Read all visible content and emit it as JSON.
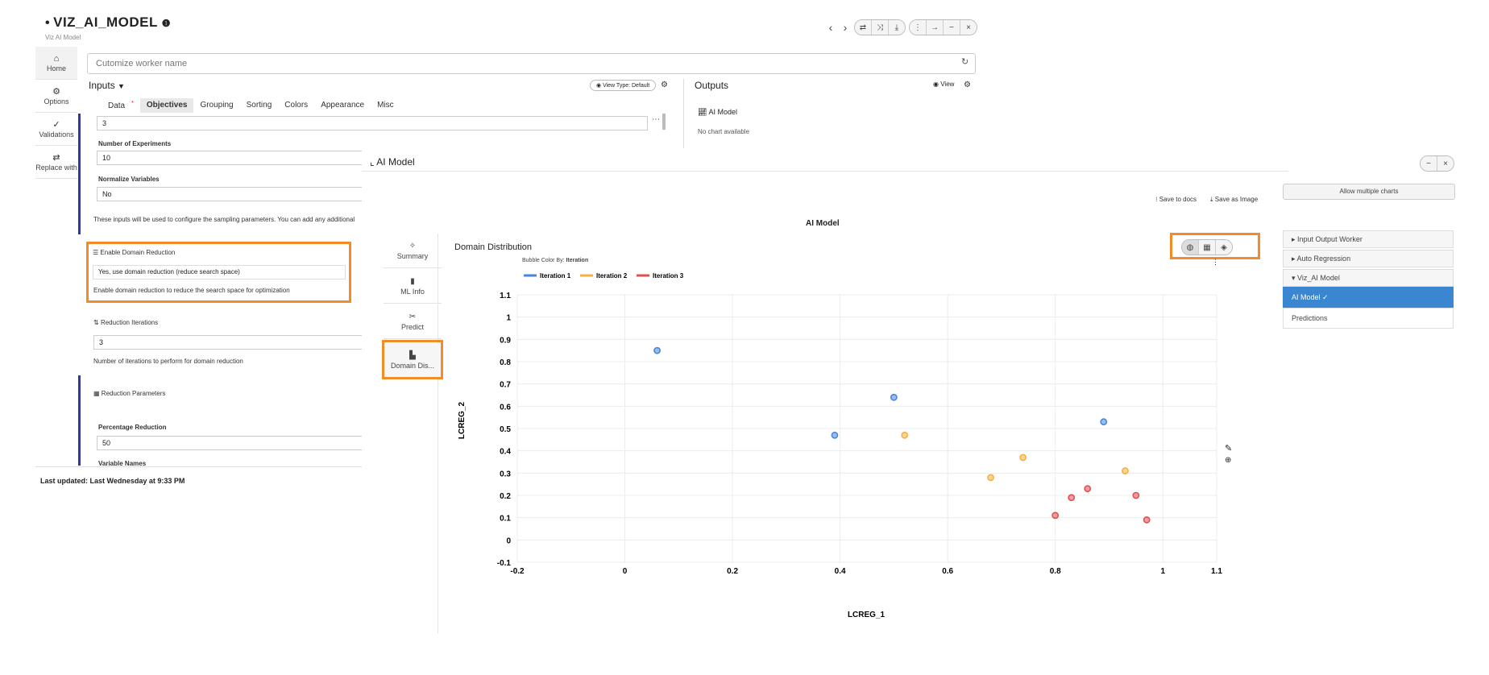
{
  "header": {
    "title": "VIZ_AI_MODEL",
    "subtitle": "Viz AI Model"
  },
  "left_nav": [
    {
      "label": "Home",
      "icon": "home-icon"
    },
    {
      "label": "Options",
      "icon": "gear-icon"
    },
    {
      "label": "Validations",
      "icon": "check-icon"
    },
    {
      "label": "Replace with",
      "icon": "swap-icon"
    }
  ],
  "worker_name": {
    "placeholder": "Cutomize worker name"
  },
  "inputs": {
    "title": "Inputs",
    "view_type": "View Type: Default",
    "tabs": [
      "Data",
      "Objectives",
      "Grouping",
      "Sorting",
      "Colors",
      "Appearance",
      "Misc"
    ],
    "active_tab": "Objectives",
    "field_top_value": "3",
    "num_experiments_label": "Number of Experiments",
    "num_experiments_value": "10",
    "normalize_label": "Normalize Variables",
    "normalize_value": "No",
    "info_text": "These inputs will be used to configure the sampling parameters. You can add any additional",
    "domain_reduction_label": "Enable Domain Reduction",
    "domain_reduction_value": "Yes, use domain reduction (reduce search space)",
    "domain_reduction_help": "Enable domain reduction to reduce the search space for optimization",
    "reduction_iterations_label": "Reduction Iterations",
    "reduction_iterations_value": "3",
    "reduction_iterations_help": "Number of iterations to perform for domain reduction",
    "reduction_params_label": "Reduction Parameters",
    "percentage_reduction_label": "Percentage Reduction",
    "percentage_reduction_value": "50",
    "variable_names_label": "Variable Names"
  },
  "outputs": {
    "title": "Outputs",
    "view_label": "View",
    "item_label": "AI Model",
    "no_chart": "No chart available"
  },
  "footer": {
    "last_updated": "Last updated: Last Wednesday at 9:33 PM"
  },
  "modal": {
    "title": "AI Model",
    "side_tabs": [
      {
        "label": "Summary",
        "icon": "summary-icon"
      },
      {
        "label": "ML Info",
        "icon": "info-icon"
      },
      {
        "label": "Predict",
        "icon": "predict-icon"
      },
      {
        "label": "Domain Dis...",
        "icon": "chart-icon"
      }
    ],
    "save_to_docs": "Save to docs",
    "save_as_image": "Save as Image",
    "chart_heading": "AI Model",
    "section_title": "Domain Distribution",
    "bubble_color_by_label": "Bubble Color By:",
    "bubble_color_by_value": "Iteration"
  },
  "right_panel": {
    "allow_multiple": "Allow multiple charts",
    "items": [
      {
        "label": "Input Output Worker",
        "type": "group"
      },
      {
        "label": "Auto Regression",
        "type": "group"
      },
      {
        "label": "Viz_AI Model",
        "type": "group"
      },
      {
        "label": "AI Model",
        "type": "active"
      },
      {
        "label": "Predictions",
        "type": "plain"
      }
    ]
  },
  "colors": {
    "accent": "#3a86d1",
    "highlight": "#f28c28",
    "iter1": "#4a86d8",
    "iter2": "#f5b041",
    "iter3": "#e05050"
  },
  "chart_data": {
    "type": "scatter",
    "title": "Domain Distribution",
    "xlabel": "LCREG_1",
    "ylabel": "LCREG_2",
    "xlim": [
      -0.2,
      1.1
    ],
    "ylim": [
      -0.1,
      1.1
    ],
    "x_ticks": [
      -0.2,
      0,
      0.2,
      0.4,
      0.6,
      0.8,
      1,
      1.1
    ],
    "y_ticks": [
      -0.1,
      0,
      0.1,
      0.2,
      0.3,
      0.4,
      0.5,
      0.6,
      0.7,
      0.8,
      0.9,
      1,
      1.1
    ],
    "grid": true,
    "legend": "top-left",
    "series": [
      {
        "name": "Iteration 1",
        "color": "#4a86d8",
        "points": [
          [
            0.06,
            0.85
          ],
          [
            0.39,
            0.47
          ],
          [
            0.5,
            0.64
          ],
          [
            0.89,
            0.53
          ]
        ]
      },
      {
        "name": "Iteration 2",
        "color": "#f5b041",
        "points": [
          [
            0.52,
            0.47
          ],
          [
            0.68,
            0.28
          ],
          [
            0.74,
            0.37
          ],
          [
            0.93,
            0.31
          ]
        ]
      },
      {
        "name": "Iteration 3",
        "color": "#e05050",
        "points": [
          [
            0.8,
            0.11
          ],
          [
            0.83,
            0.19
          ],
          [
            0.86,
            0.23
          ],
          [
            0.95,
            0.2
          ],
          [
            0.97,
            0.09
          ]
        ]
      }
    ]
  }
}
